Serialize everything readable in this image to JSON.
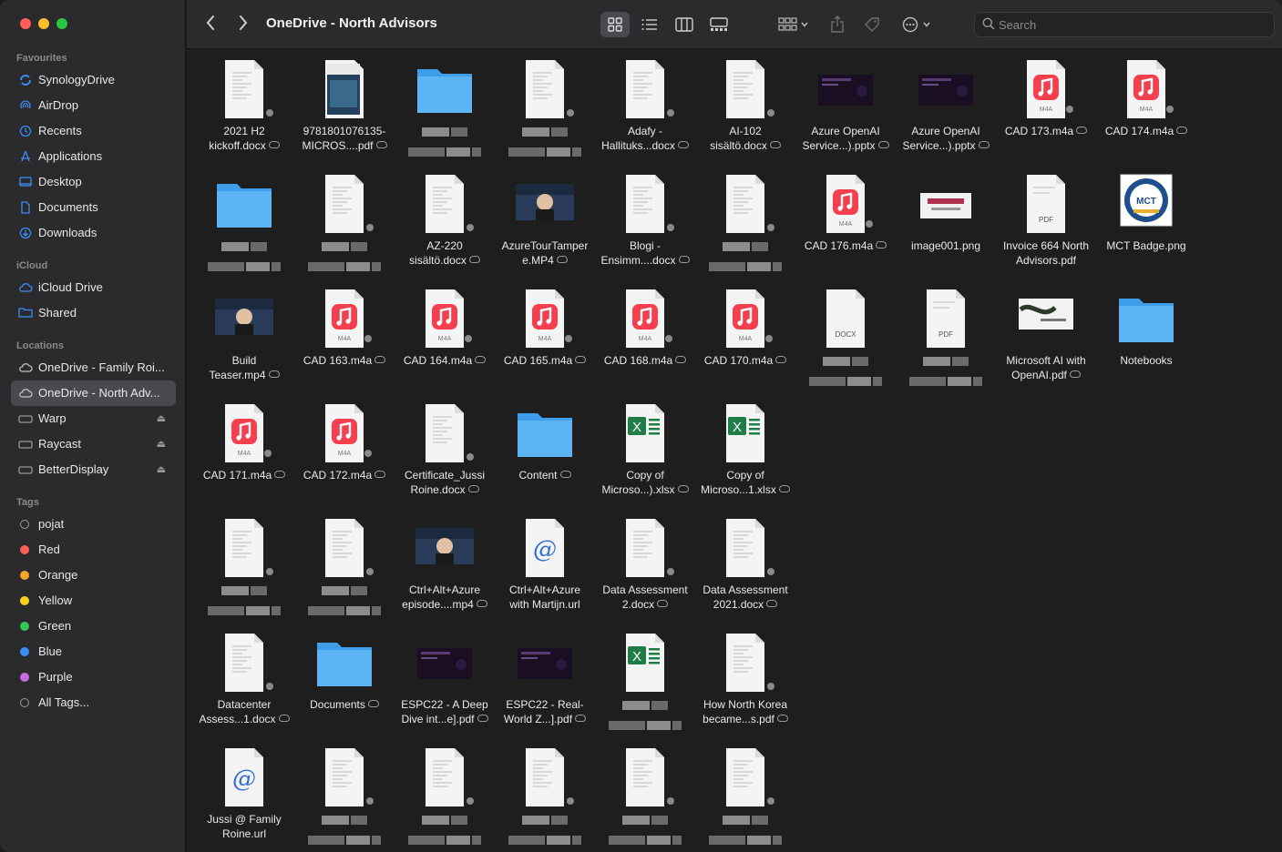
{
  "toolbar": {
    "title": "OneDrive - North Advisors",
    "search_placeholder": "Search"
  },
  "sidebar": {
    "favourites_head": "Favourites",
    "favourites": [
      {
        "label": "SynologyDrive",
        "icon": "synology-icon"
      },
      {
        "label": "AirDrop",
        "icon": "airdrop-icon"
      },
      {
        "label": "Recents",
        "icon": "clock-icon"
      },
      {
        "label": "Applications",
        "icon": "applications-icon"
      },
      {
        "label": "Desktop",
        "icon": "desktop-icon"
      },
      {
        "label": "Documents",
        "icon": "document-icon"
      },
      {
        "label": "Downloads",
        "icon": "download-icon"
      }
    ],
    "icloud_head": "iCloud",
    "icloud": [
      {
        "label": "iCloud Drive",
        "icon": "cloud-icon"
      },
      {
        "label": "Shared",
        "icon": "shared-folder-icon"
      }
    ],
    "locations_head": "Locations",
    "locations": [
      {
        "label": "OneDrive - Family Roi...",
        "icon": "cloud-icon"
      },
      {
        "label": "OneDrive - North Adv...",
        "icon": "cloud-icon",
        "selected": true
      },
      {
        "label": "Warp",
        "icon": "drive-icon",
        "eject": true
      },
      {
        "label": "Raycast",
        "icon": "drive-icon",
        "eject": true
      },
      {
        "label": "BetterDisplay",
        "icon": "drive-icon",
        "eject": true
      }
    ],
    "tags_head": "Tags",
    "tags": [
      {
        "label": "pojat",
        "color": "transparent"
      },
      {
        "label": "Red",
        "color": "#ff5f57"
      },
      {
        "label": "Orange",
        "color": "#f5a623"
      },
      {
        "label": "Yellow",
        "color": "#f8d21a"
      },
      {
        "label": "Green",
        "color": "#34c759"
      },
      {
        "label": "Blue",
        "color": "#3b8cf5"
      },
      {
        "label": "Purple",
        "color": "#c86ae0"
      },
      {
        "label": "All Tags...",
        "color": "transparent"
      }
    ]
  },
  "files": [
    {
      "l1": "2021 H2",
      "l2": "kickoff.docx",
      "type": "doc",
      "cloud": true
    },
    {
      "l1": "9781801076135-",
      "l2": "MICROS....pdf",
      "type": "book",
      "cloud": true
    },
    {
      "l1": "",
      "l2": "",
      "type": "folder",
      "cloud": false
    },
    {
      "l1": "",
      "l2": "",
      "type": "doc",
      "cloud": false
    },
    {
      "l1": "Adafy -",
      "l2": "Hallituks...docx",
      "type": "doc",
      "cloud": true
    },
    {
      "l1": "AI-102",
      "l2": "sisältö.docx",
      "type": "doc",
      "cloud": true
    },
    {
      "l1": "Azure OpenAI",
      "l2": "Service...).pptx",
      "type": "slide",
      "cloud": true
    },
    {
      "l1": "Azure OpenAI",
      "l2": "Service...).pptx",
      "type": "slide",
      "cloud": true
    },
    {
      "l1": "CAD 173.m4a",
      "l2": "",
      "type": "m4a",
      "cloud": true
    },
    {
      "l1": "CAD 174.m4a",
      "l2": "",
      "type": "m4a",
      "cloud": true
    },
    {
      "l1": "",
      "l2": "",
      "type": "folder",
      "cloud": false
    },
    {
      "l1": "",
      "l2": "",
      "type": "doc",
      "cloud": false
    },
    {
      "l1": "AZ-220",
      "l2": "sisältö.docx",
      "type": "doc",
      "cloud": true
    },
    {
      "l1": "AzureTourTamper",
      "l2": "e.MP4",
      "type": "video",
      "cloud": true
    },
    {
      "l1": "Blogi -",
      "l2": "Ensimm....docx",
      "type": "doc",
      "cloud": true
    },
    {
      "l1": "",
      "l2": "",
      "type": "doc",
      "cloud": false
    },
    {
      "l1": "CAD 176.m4a",
      "l2": "",
      "type": "m4a",
      "cloud": true
    },
    {
      "l1": "image001.png",
      "l2": "",
      "type": "image",
      "cloud": false
    },
    {
      "l1": "Invoice 664 North",
      "l2": "Advisors.pdf",
      "type": "pdf",
      "cloud": false
    },
    {
      "l1": "MCT Badge.png",
      "l2": "",
      "type": "badge",
      "cloud": false
    },
    {
      "l1": "Build",
      "l2": "Teaser.mp4",
      "type": "video",
      "cloud": true
    },
    {
      "l1": "CAD 163.m4a",
      "l2": "",
      "type": "m4a",
      "cloud": true
    },
    {
      "l1": "CAD 164.m4a",
      "l2": "",
      "type": "m4a",
      "cloud": true
    },
    {
      "l1": "CAD 165.m4a",
      "l2": "",
      "type": "m4a",
      "cloud": true
    },
    {
      "l1": "CAD 168.m4a",
      "l2": "",
      "type": "m4a",
      "cloud": true
    },
    {
      "l1": "CAD 170.m4a",
      "l2": "",
      "type": "m4a",
      "cloud": true
    },
    {
      "l1": "",
      "l2": "",
      "type": "docx-plain",
      "cloud": false
    },
    {
      "l1": "",
      "l2": "",
      "type": "pdf",
      "cloud": false
    },
    {
      "l1": "Microsoft AI  with",
      "l2": "OpenAI.pdf",
      "type": "slide-light",
      "cloud": true
    },
    {
      "l1": "Notebooks",
      "l2": "",
      "type": "folder",
      "cloud": false
    },
    {
      "l1": "CAD 171.m4a",
      "l2": "",
      "type": "m4a",
      "cloud": true
    },
    {
      "l1": "CAD 172.m4a",
      "l2": "",
      "type": "m4a",
      "cloud": true
    },
    {
      "l1": "Certificate_Jussi",
      "l2": "Roine.docx",
      "type": "doc",
      "cloud": true
    },
    {
      "l1": "Content",
      "l2": "",
      "type": "folder",
      "cloud": true
    },
    {
      "l1": "Copy of",
      "l2": "Microso...).xlsx",
      "type": "xlsx",
      "cloud": true
    },
    {
      "l1": "Copy of",
      "l2": "Microso...1.xlsx",
      "type": "xlsx",
      "cloud": true
    },
    {
      "l1": "",
      "l2": "",
      "type": "none",
      "cloud": false
    },
    {
      "l1": "",
      "l2": "",
      "type": "none",
      "cloud": false
    },
    {
      "l1": "",
      "l2": "",
      "type": "none",
      "cloud": false
    },
    {
      "l1": "",
      "l2": "",
      "type": "none",
      "cloud": false
    },
    {
      "l1": "",
      "l2": "",
      "type": "doc",
      "cloud": false
    },
    {
      "l1": "",
      "l2": "",
      "type": "doc",
      "cloud": false
    },
    {
      "l1": "Ctrl+Alt+Azure",
      "l2": "episode....mp4",
      "type": "video",
      "cloud": true
    },
    {
      "l1": "Ctrl+Alt+Azure",
      "l2": "with Martijn.url",
      "type": "url",
      "cloud": false
    },
    {
      "l1": "Data Assessment",
      "l2": "2.docx",
      "type": "doc",
      "cloud": true
    },
    {
      "l1": "Data Assessment",
      "l2": "2021.docx",
      "type": "doc",
      "cloud": true
    },
    {
      "l1": "",
      "l2": "",
      "type": "none",
      "cloud": false
    },
    {
      "l1": "",
      "l2": "",
      "type": "none",
      "cloud": false
    },
    {
      "l1": "",
      "l2": "",
      "type": "none",
      "cloud": false
    },
    {
      "l1": "",
      "l2": "",
      "type": "none",
      "cloud": false
    },
    {
      "l1": "Datacenter",
      "l2": "Assess...1.docx",
      "type": "doc",
      "cloud": true
    },
    {
      "l1": "Documents",
      "l2": "",
      "type": "folder",
      "cloud": true
    },
    {
      "l1": "ESPC22 - A Deep",
      "l2": "Dive int...e].pdf",
      "type": "slide",
      "cloud": true
    },
    {
      "l1": "ESPC22 - Real-",
      "l2": "World Z...].pdf",
      "type": "slide",
      "cloud": true
    },
    {
      "l1": "",
      "l2": "",
      "type": "xlsx",
      "cloud": false
    },
    {
      "l1": "How North Korea",
      "l2": "became...s.pdf",
      "type": "doc",
      "cloud": true
    },
    {
      "l1": "",
      "l2": "",
      "type": "none",
      "cloud": false
    },
    {
      "l1": "",
      "l2": "",
      "type": "none",
      "cloud": false
    },
    {
      "l1": "",
      "l2": "",
      "type": "none",
      "cloud": false
    },
    {
      "l1": "",
      "l2": "",
      "type": "none",
      "cloud": false
    },
    {
      "l1": "Jussi @ Family",
      "l2": "Roine.url",
      "type": "url",
      "cloud": false
    },
    {
      "l1": "",
      "l2": "",
      "type": "doc",
      "cloud": false
    },
    {
      "l1": "",
      "l2": "",
      "type": "doc",
      "cloud": false
    },
    {
      "l1": "",
      "l2": "",
      "type": "doc",
      "cloud": false
    },
    {
      "l1": "",
      "l2": "",
      "type": "doc",
      "cloud": false
    },
    {
      "l1": "",
      "l2": "",
      "type": "doc",
      "cloud": false
    }
  ],
  "icons": {
    "m4a_badge": "M4A",
    "pdf_badge": "PDF",
    "docx_badge": "DOCX",
    "url_glyph": "@",
    "xlsx_glyph": "X",
    "mct_text": "MCT"
  }
}
